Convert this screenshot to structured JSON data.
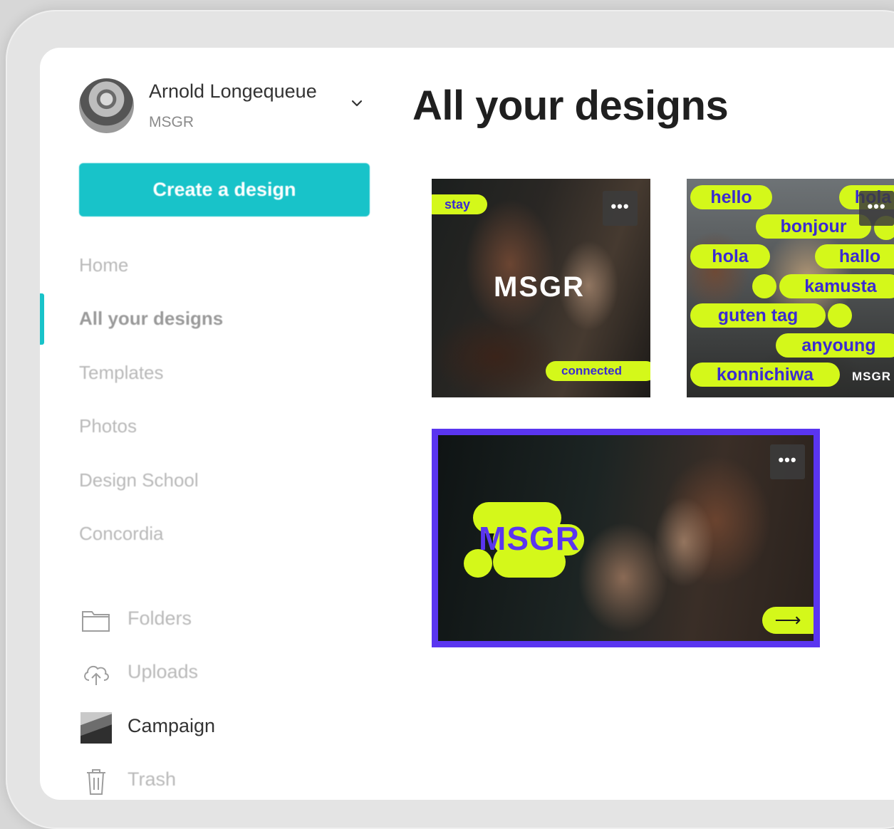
{
  "user": {
    "name": "Arnold Longequeue",
    "team": "MSGR"
  },
  "sidebar": {
    "create_label": "Create a design",
    "nav": [
      {
        "label": "Home",
        "active": false
      },
      {
        "label": "All your designs",
        "active": true
      },
      {
        "label": "Templates",
        "active": false
      },
      {
        "label": "Photos",
        "active": false
      },
      {
        "label": "Design School",
        "active": false
      },
      {
        "label": "Concordia",
        "active": false
      }
    ],
    "tools": [
      {
        "label": "Folders",
        "icon": "folder-icon"
      },
      {
        "label": "Uploads",
        "icon": "cloud-upload-icon"
      },
      {
        "label": "Campaign",
        "icon": "campaign-thumbnail"
      },
      {
        "label": "Trash",
        "icon": "trash-icon"
      }
    ]
  },
  "main": {
    "title": "All your designs",
    "more_label": "•••",
    "designs": [
      {
        "pills": [
          "stay",
          "connected"
        ],
        "logo": "MSGR"
      },
      {
        "pills": [
          "hello",
          "hola",
          "bonjour",
          "hola",
          "hallo",
          "kamusta",
          "guten tag",
          "anyoung",
          "konnichiwa"
        ],
        "logo": "MSGR"
      },
      {
        "logo": "MSGR",
        "arrow": "⟶"
      }
    ]
  },
  "colors": {
    "accent": "#18c3c9",
    "lime": "#d4f81a",
    "violet": "#5a35f0"
  }
}
